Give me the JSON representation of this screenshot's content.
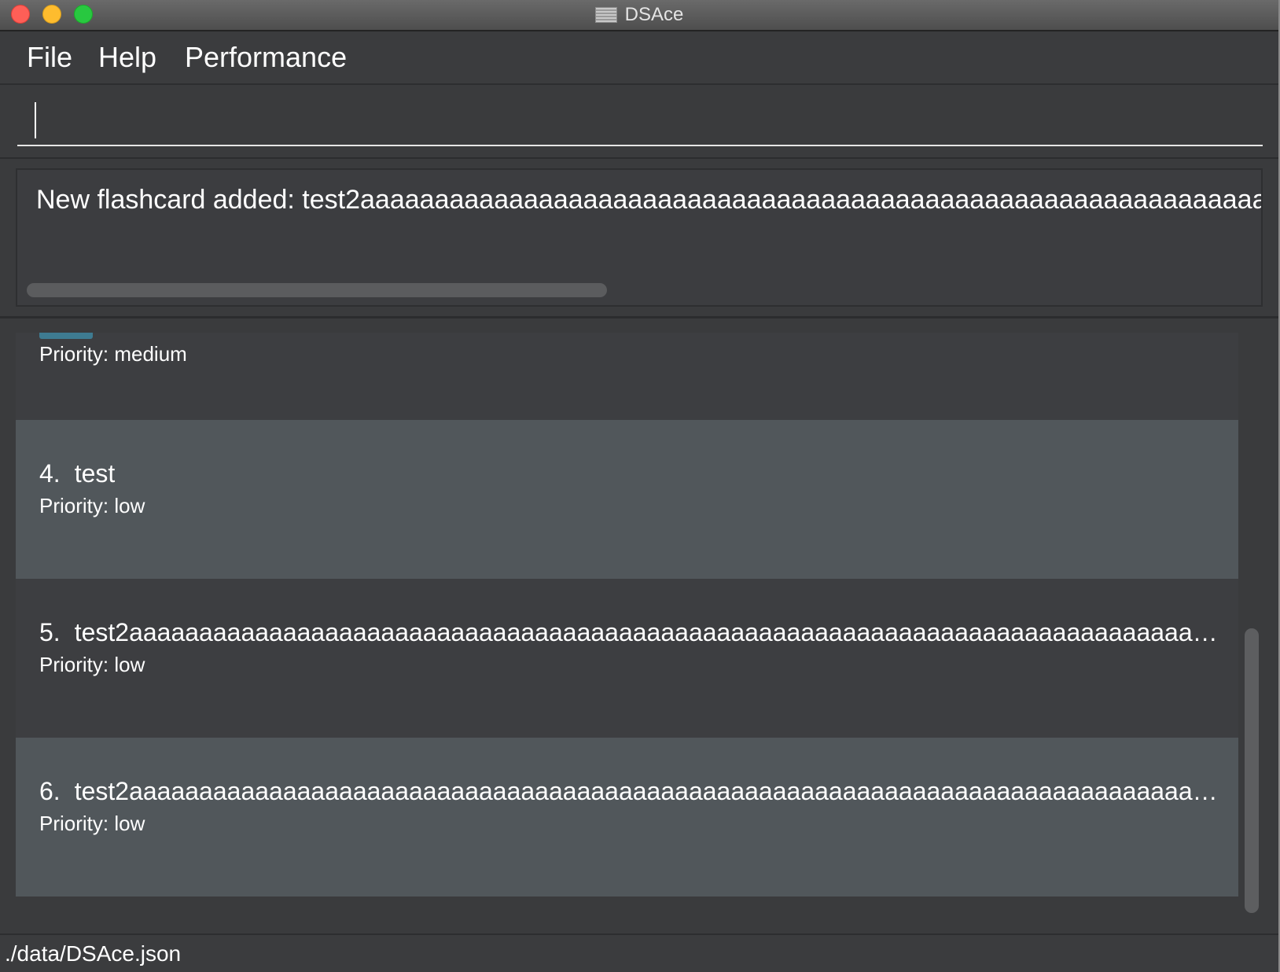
{
  "window": {
    "title": "DSAce"
  },
  "menu": {
    "items": [
      "File",
      "Help",
      "Performance"
    ]
  },
  "command": {
    "value": "",
    "placeholder": ""
  },
  "result": {
    "text": "New flashcard added: test2aaaaaaaaaaaaaaaaaaaaaaaaaaaaaaaaaaaaaaaaaaaaaaaaaaaaaaaaaaaaaa"
  },
  "flashcards": [
    {
      "index": "",
      "title": "",
      "priority": "Priority: medium",
      "tag_color": "#3e7b91"
    },
    {
      "index": "4.",
      "title": "test",
      "priority": "Priority: low"
    },
    {
      "index": "5.",
      "title": "test2aaaaaaaaaaaaaaaaaaaaaaaaaaaaaaaaaaaaaaaaaaaaaaaaaaaaaaaaaaaaaaaaaaaaaaaaaaaaaa",
      "priority": "Priority: low"
    },
    {
      "index": "6.",
      "title": "test2aaaaaaaaaaaaaaaaaaaaaaaaaaaaaaaaaaaaaaaaaaaaaaaaaaaaaaaaaaaaaaaaaaaaaaaaaaaaaaaa...",
      "priority": "Priority: low"
    }
  ],
  "status": {
    "path": "./data/DSAce.json"
  },
  "colors": {
    "background": "#3a3b3d",
    "card_dark": "#3d3e41",
    "card_light": "#51575b",
    "text": "#ffffff"
  }
}
